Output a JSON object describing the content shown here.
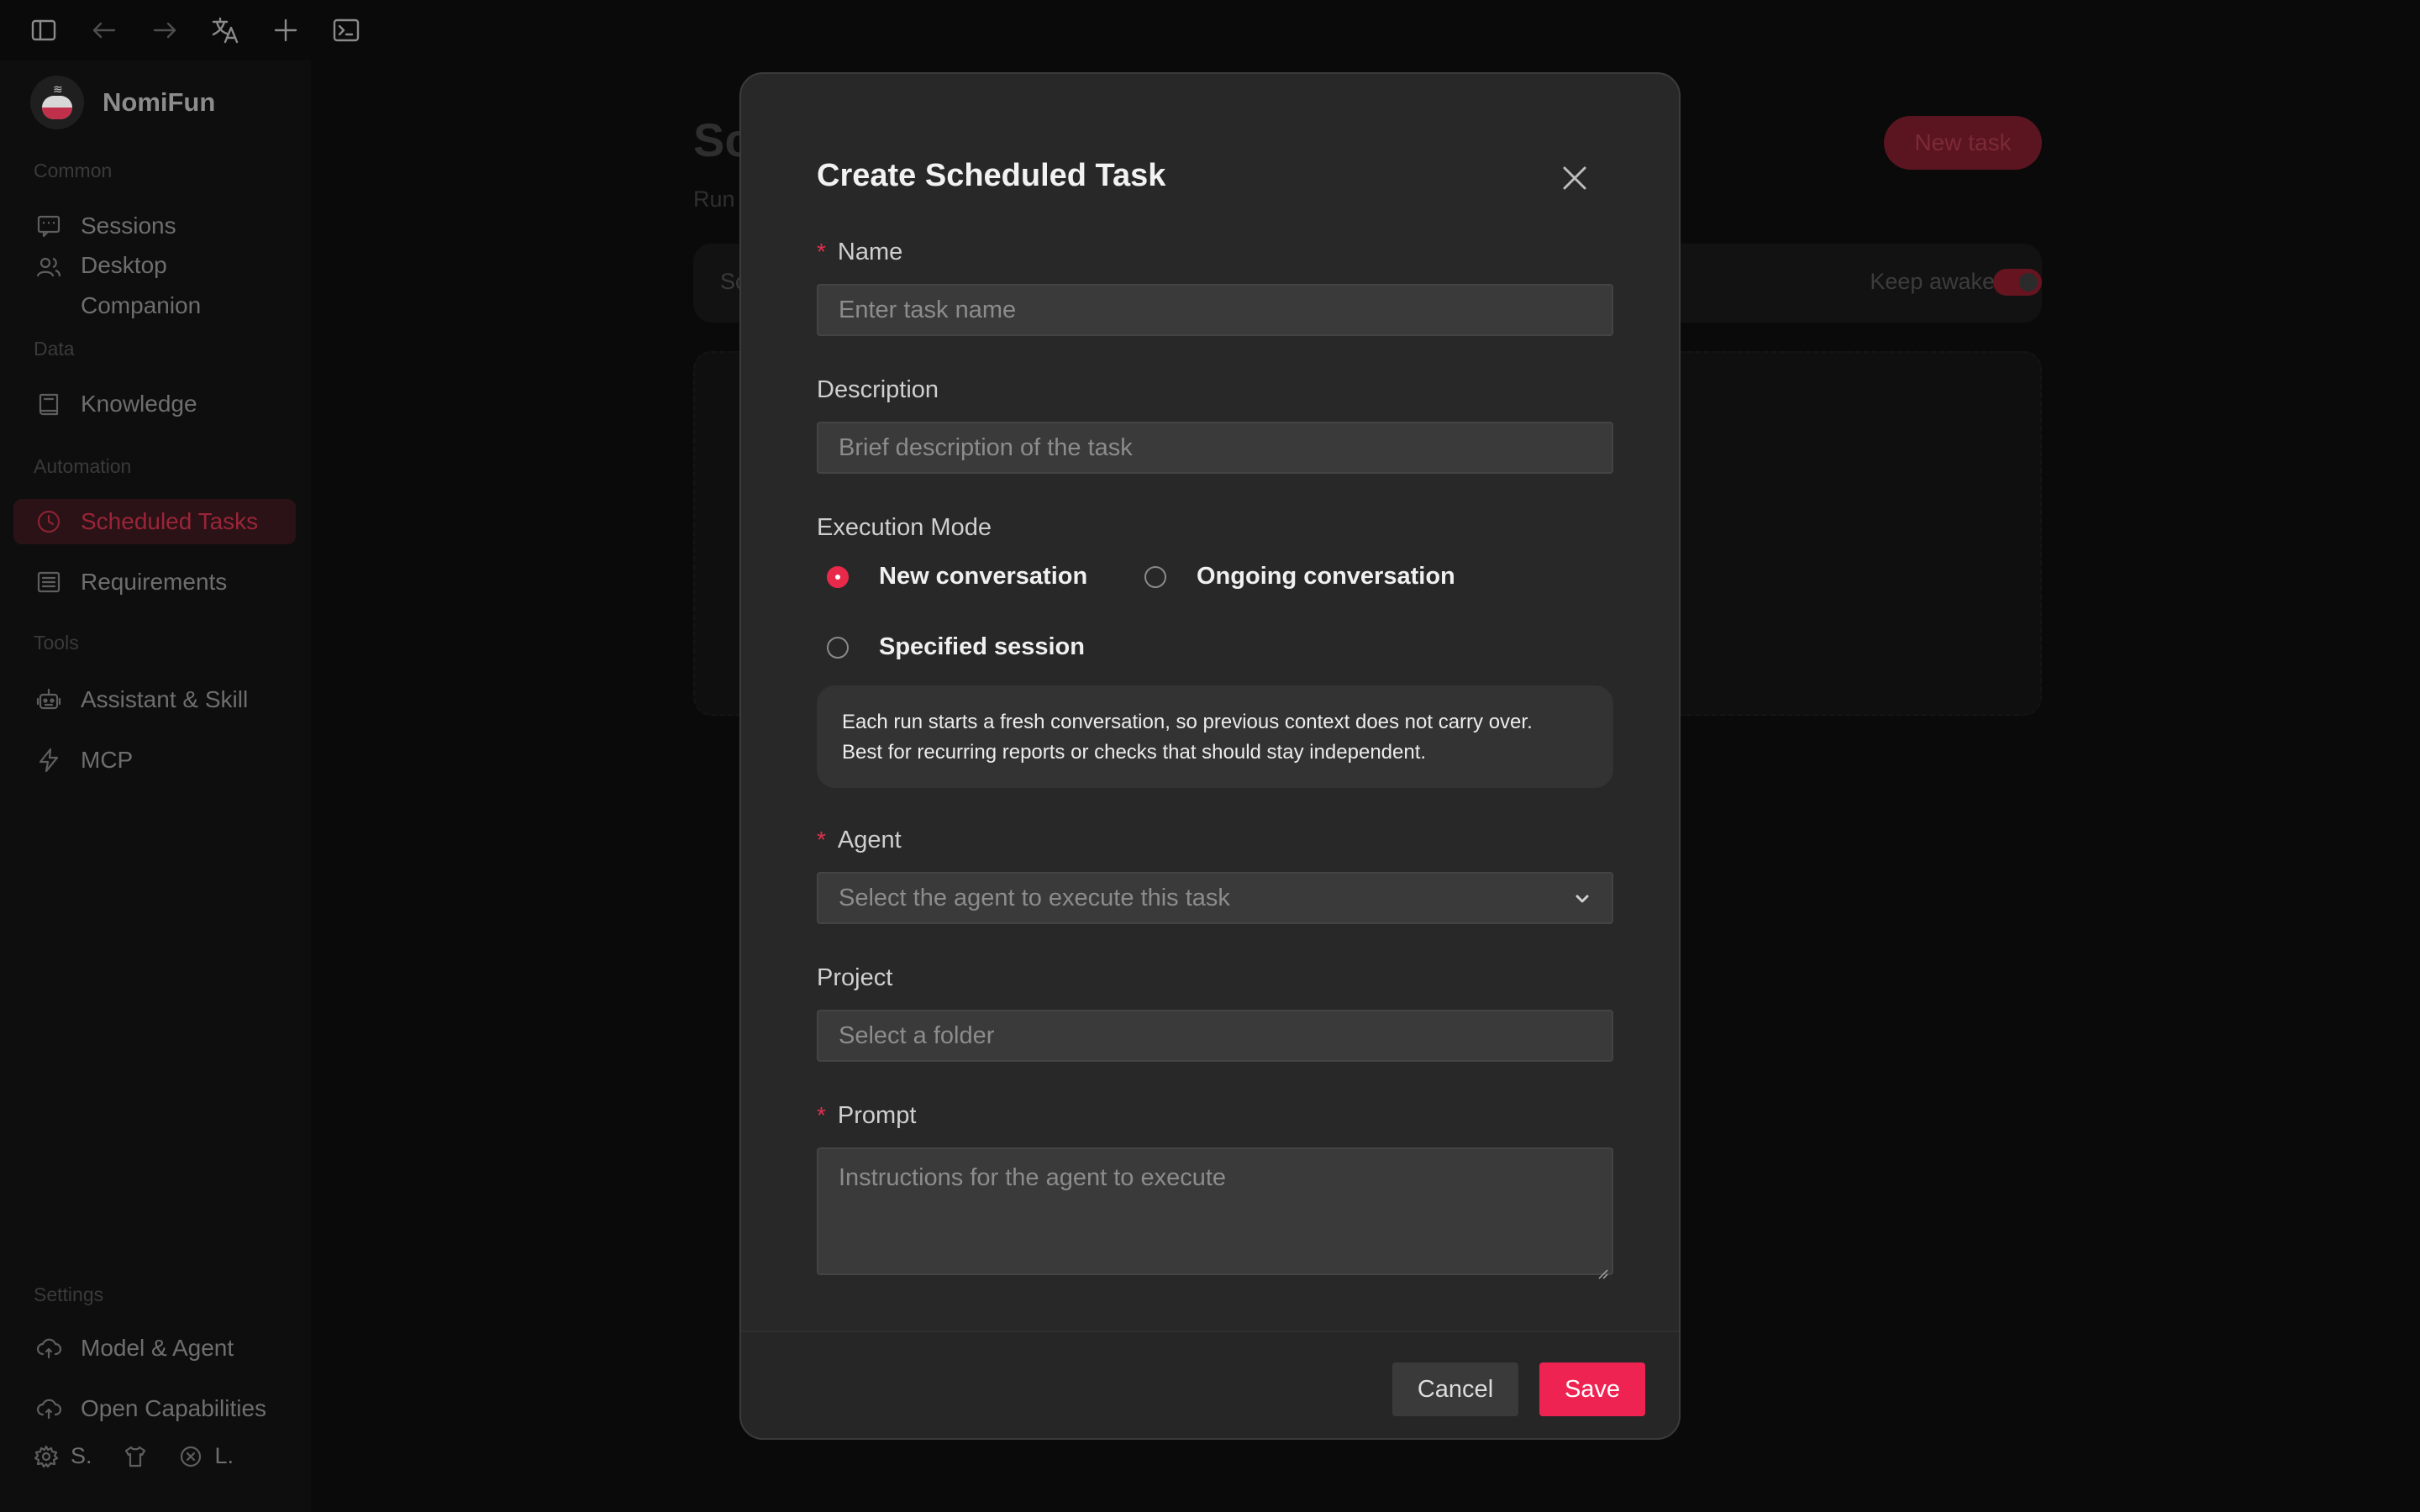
{
  "app": {
    "name": "NomiFun"
  },
  "topbar": {
    "icons": [
      "sidebar-toggle-icon",
      "arrow-left-icon",
      "arrow-right-icon",
      "translate-icon",
      "plus-icon",
      "terminal-icon"
    ]
  },
  "sidebar": {
    "sections": {
      "common": "Common",
      "data": "Data",
      "automation": "Automation",
      "tools": "Tools",
      "settings": "Settings"
    },
    "items": {
      "sessions": "Sessions",
      "desktop_companion": "Desktop Companion",
      "knowledge": "Knowledge",
      "scheduled_tasks": "Scheduled Tasks",
      "requirements": "Requirements",
      "assistant_skill": "Assistant & Skill",
      "mcp": "MCP",
      "model_agent": "Model & Agent",
      "open_capabilities": "Open Capabilities"
    },
    "footer": {
      "settings_short": "S.",
      "logout_short": "L."
    }
  },
  "background_page": {
    "title": "Sc",
    "subtitle": "Run",
    "new_task_label": "New task",
    "toolbar_label": "Sc",
    "keep_awake_label": "Keep awake",
    "keep_awake_on": true
  },
  "modal": {
    "title": "Create Scheduled Task",
    "name": {
      "label": "Name",
      "required": "*",
      "placeholder": "Enter task name",
      "value": ""
    },
    "description": {
      "label": "Description",
      "placeholder": "Brief description of the task",
      "value": ""
    },
    "execution_mode": {
      "label": "Execution Mode",
      "options": [
        "New conversation",
        "Ongoing conversation",
        "Specified session"
      ],
      "selected": "New conversation",
      "info_line1": "Each run starts a fresh conversation, so previous context does not carry over.",
      "info_line2": "Best for recurring reports or checks that should stay independent."
    },
    "agent": {
      "label": "Agent",
      "required": "*",
      "placeholder": "Select the agent to execute this task"
    },
    "project": {
      "label": "Project",
      "placeholder": "Select a folder"
    },
    "prompt": {
      "label": "Prompt",
      "required": "*",
      "placeholder": "Instructions for the agent to execute"
    },
    "buttons": {
      "cancel": "Cancel",
      "save": "Save"
    }
  },
  "colors": {
    "accent": "#ef2352",
    "modal_bg": "#282828",
    "input_bg": "#3a3a3a",
    "page_bg": "#0a0a0a"
  }
}
